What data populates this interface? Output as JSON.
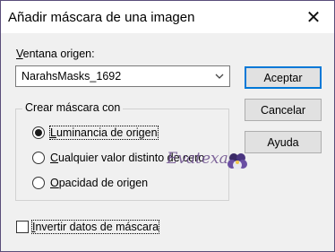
{
  "window": {
    "title": "Añadir máscara de una imagen",
    "close_glyph": "✕"
  },
  "source": {
    "label_accel": "V",
    "label_rest": "entana origen:",
    "selected": "NarahsMasks_1692"
  },
  "buttons": {
    "ok": "Aceptar",
    "cancel": "Cancelar",
    "help": "Ayuda"
  },
  "group": {
    "title": "Crear máscara con",
    "options": [
      {
        "accel": "L",
        "rest": "uminancia de origen",
        "checked": true
      },
      {
        "accel": "C",
        "rest": "ualquier valor distinto de cero",
        "checked": false
      },
      {
        "accel": "O",
        "rest": "pacidad de origen",
        "checked": false
      }
    ]
  },
  "invert": {
    "accel": "I",
    "rest": "nvertir datos de máscara",
    "checked": false
  },
  "watermark": {
    "text": "Evatexas",
    "icon": "pansy-flower-icon"
  }
}
